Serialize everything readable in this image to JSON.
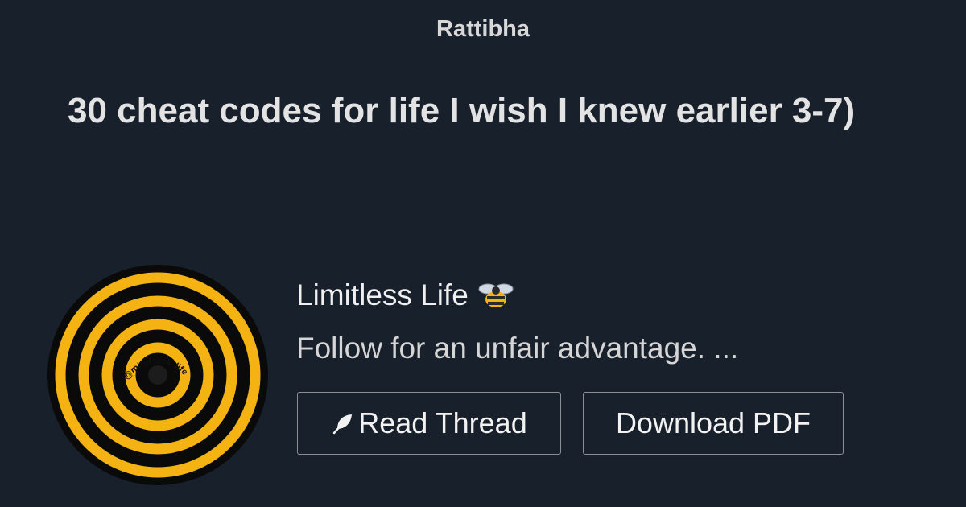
{
  "site": {
    "brand": "Rattibha"
  },
  "thread": {
    "title": "30 cheat codes for life I wish I knew earlier 3-7)"
  },
  "author": {
    "name": "Limitless Life",
    "bio": "Follow for an unfair advantage. ...",
    "avatar_handle": "@mindset4_life",
    "emoji_icon": "bee-icon"
  },
  "actions": {
    "read_thread_label": "Read Thread",
    "read_thread_icon": "feather-icon",
    "download_pdf_label": "Download PDF"
  },
  "colors": {
    "background": "#18202b",
    "avatar_ring": "#f5b313",
    "avatar_dark": "#0a0a0a",
    "button_border": "#8a8f96"
  }
}
